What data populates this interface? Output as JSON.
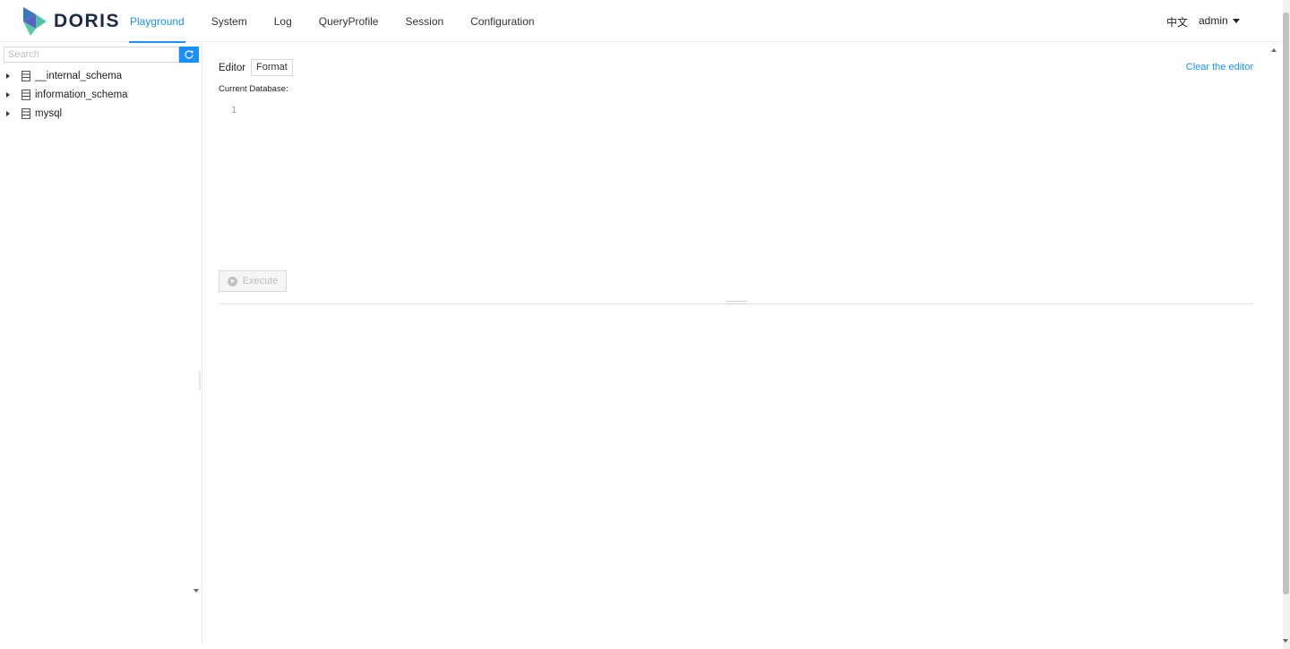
{
  "brand": {
    "name": "DORIS",
    "accent": "#1890ff"
  },
  "nav": {
    "items": [
      {
        "label": "Playground",
        "active": true
      },
      {
        "label": "System",
        "active": false
      },
      {
        "label": "Log",
        "active": false
      },
      {
        "label": "QueryProfile",
        "active": false
      },
      {
        "label": "Session",
        "active": false
      },
      {
        "label": "Configuration",
        "active": false
      }
    ],
    "language": "中文",
    "user": "admin"
  },
  "sidebar": {
    "search_placeholder": "Search",
    "refresh_icon": "refresh-icon",
    "databases": [
      {
        "name": "__internal_schema",
        "icon": "database-icon"
      },
      {
        "name": "information_schema",
        "icon": "database-icon"
      },
      {
        "name": "mysql",
        "icon": "database-icon"
      }
    ]
  },
  "editor": {
    "label": "Editor",
    "format_label": "Format",
    "clear_label": "Clear the editor",
    "current_db_label": "Current Database:",
    "line_number": "1",
    "execute_label": "Execute"
  }
}
